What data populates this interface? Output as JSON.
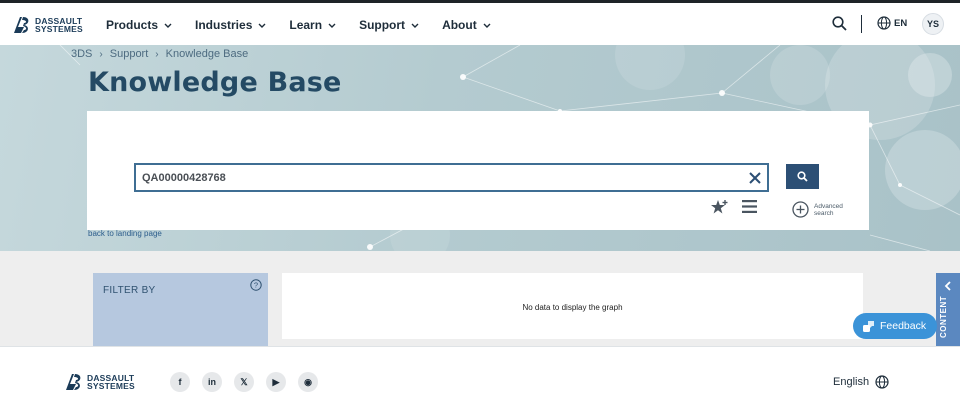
{
  "brand": {
    "line1": "DASSAULT",
    "line2": "SYSTEMES"
  },
  "nav": {
    "items": [
      {
        "label": "Products"
      },
      {
        "label": "Industries"
      },
      {
        "label": "Learn"
      },
      {
        "label": "Support"
      },
      {
        "label": "About"
      }
    ],
    "language": "EN",
    "avatar_initials": "YS"
  },
  "breadcrumb": [
    "3DS",
    "Support",
    "Knowledge Base"
  ],
  "page_title": "Knowledge Base",
  "search": {
    "value": "QA00000428768",
    "advanced_label": "Advanced search"
  },
  "back_link": "back to landing page",
  "filter": {
    "title": "FILTER BY"
  },
  "graph": {
    "message": "No data to display the graph"
  },
  "side_tab": {
    "label": "CONTENT"
  },
  "feedback": {
    "label": "Feedback"
  },
  "footer": {
    "language": "English",
    "socials": [
      {
        "icon": "facebook-icon",
        "glyph": "f"
      },
      {
        "icon": "linkedin-icon",
        "glyph": "in"
      },
      {
        "icon": "x-twitter-icon",
        "glyph": "𝕏"
      },
      {
        "icon": "youtube-icon",
        "glyph": "▶"
      },
      {
        "icon": "rss-icon",
        "glyph": "◉"
      }
    ]
  },
  "colors": {
    "accent": "#2c4f75",
    "feedback": "#3b93d8",
    "filter_bg": "#b6c8df",
    "side_tab": "#5b88c0"
  }
}
